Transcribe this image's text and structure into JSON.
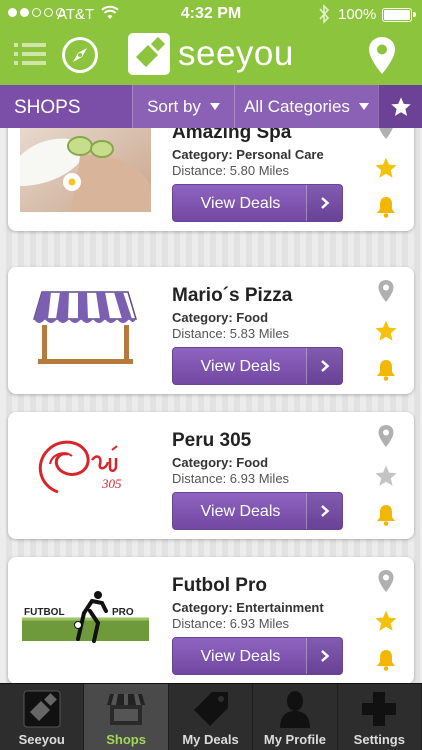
{
  "status_bar": {
    "carrier": "AT&T",
    "time": "4:32 PM",
    "battery": "100%"
  },
  "header": {
    "brand": "seeyou",
    "icons": [
      "menu-icon",
      "compass-icon",
      "location-pin-icon"
    ]
  },
  "filter_bar": {
    "title": "SHOPS",
    "sort_label": "Sort by",
    "category_label": "All Categories"
  },
  "shops": [
    {
      "name": "Amazing Spa",
      "category": "Category: Personal Care",
      "distance": "Distance: 5.80 Miles",
      "button": "View Deals",
      "favorite": true
    },
    {
      "name": "Mario´s Pizza",
      "category": "Category: Food",
      "distance": "Distance: 5.83 Miles",
      "button": "View Deals",
      "favorite": true
    },
    {
      "name": "Peru 305",
      "category": "Category: Food",
      "distance": "Distance: 6.93 Miles",
      "button": "View Deals",
      "favorite": false,
      "logo_text": "305"
    },
    {
      "name": "Futbol Pro",
      "category": "Category: Entertainment",
      "distance": "Distance: 6.93 Miles",
      "button": "View Deals",
      "favorite": true,
      "logo_left": "FUTBOL",
      "logo_right": "PRO"
    }
  ],
  "tabs": [
    {
      "label": "Seeyou",
      "active": false
    },
    {
      "label": "Shops",
      "active": true
    },
    {
      "label": "My Deals",
      "active": false
    },
    {
      "label": "My Profile",
      "active": false
    },
    {
      "label": "Settings",
      "active": false
    }
  ],
  "colors": {
    "brand_green": "#8cc43d",
    "purple": "#7b4fa8",
    "star_gold": "#f4c20d",
    "bell_gold": "#f2b705",
    "tab_active_green": "#a4d65e"
  }
}
